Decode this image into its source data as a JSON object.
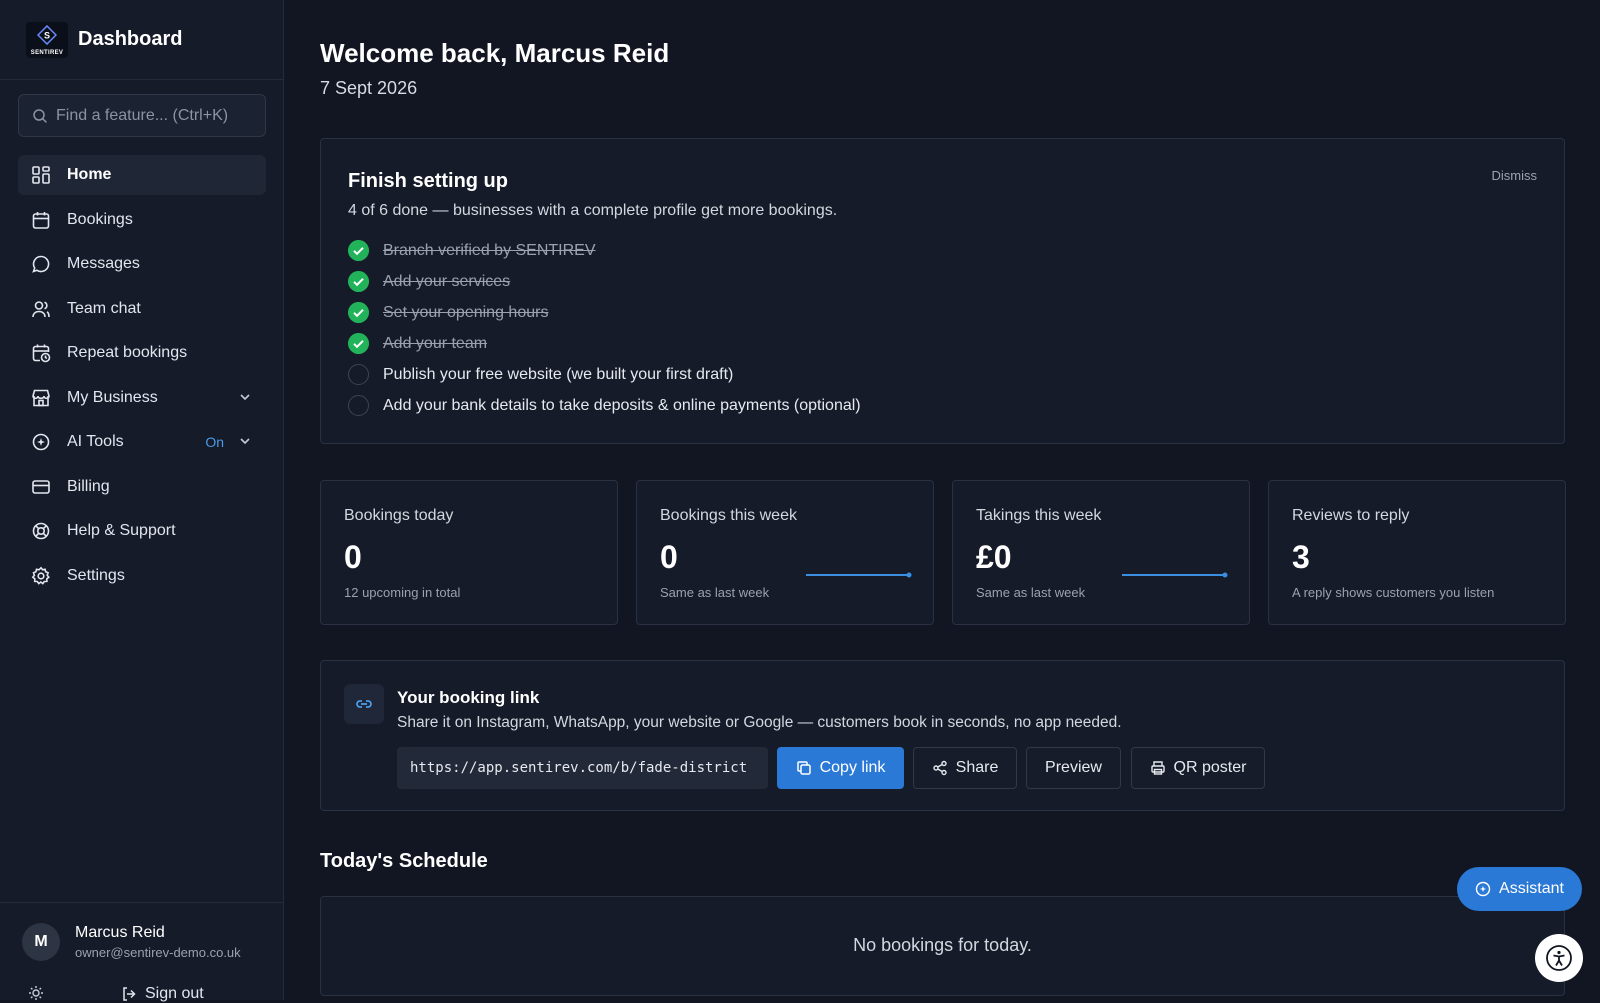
{
  "brand": {
    "title": "Dashboard",
    "logo_letter": "S",
    "logo_text": "SENTIREV"
  },
  "search": {
    "placeholder": "Find a feature... (Ctrl+K)"
  },
  "nav": [
    {
      "label": "Home",
      "icon": "grid-icon",
      "active": true
    },
    {
      "label": "Bookings",
      "icon": "calendar-icon"
    },
    {
      "label": "Messages",
      "icon": "chat-bubble-icon"
    },
    {
      "label": "Team chat",
      "icon": "users-icon"
    },
    {
      "label": "Repeat bookings",
      "icon": "calendar-clock-icon"
    },
    {
      "label": "My Business",
      "icon": "store-icon",
      "expandable": true
    },
    {
      "label": "AI Tools",
      "icon": "ai-icon",
      "expandable": true,
      "badge": "On"
    },
    {
      "label": "Billing",
      "icon": "credit-card-icon"
    },
    {
      "label": "Help & Support",
      "icon": "lifebuoy-icon"
    },
    {
      "label": "Settings",
      "icon": "gear-icon"
    }
  ],
  "user": {
    "initial": "M",
    "name": "Marcus Reid",
    "email": "owner@sentirev-demo.co.uk",
    "sign_out": "Sign out"
  },
  "header": {
    "welcome": "Welcome back, Marcus Reid",
    "date": "7 Sept 2026"
  },
  "setup": {
    "title": "Finish setting up",
    "subtitle": "4 of 6 done — businesses with a complete profile get more bookings.",
    "dismiss": "Dismiss",
    "tasks": [
      {
        "label": "Branch verified by SENTIREV",
        "done": true
      },
      {
        "label": "Add your services",
        "done": true
      },
      {
        "label": "Set your opening hours",
        "done": true
      },
      {
        "label": "Add your team",
        "done": true
      },
      {
        "label": "Publish your free website (we built your first draft)",
        "done": false
      },
      {
        "label": "Add your bank details to take deposits & online payments (optional)",
        "done": false
      }
    ]
  },
  "stats": [
    {
      "label": "Bookings today",
      "value": "0",
      "sub": "12 upcoming in total"
    },
    {
      "label": "Bookings this week",
      "value": "0",
      "sub": "Same as last week"
    },
    {
      "label": "Takings this week",
      "value": "£0",
      "sub": "Same as last week"
    },
    {
      "label": "Reviews to reply",
      "value": "3",
      "sub": "A reply shows customers you listen"
    }
  ],
  "booking_link": {
    "title": "Your booking link",
    "subtitle": "Share it on Instagram, WhatsApp, your website or Google — customers book in seconds, no app needed.",
    "url": "https://app.sentirev.com/b/fade-district",
    "copy": "Copy link",
    "share": "Share",
    "preview": "Preview",
    "qr": "QR poster"
  },
  "schedule": {
    "title": "Today's Schedule",
    "empty": "No bookings for today."
  },
  "assistant": {
    "label": "Assistant"
  },
  "colors": {
    "accent": "#2a79d6",
    "success": "#22b35a",
    "background": "#111622",
    "card": "#151b28"
  }
}
